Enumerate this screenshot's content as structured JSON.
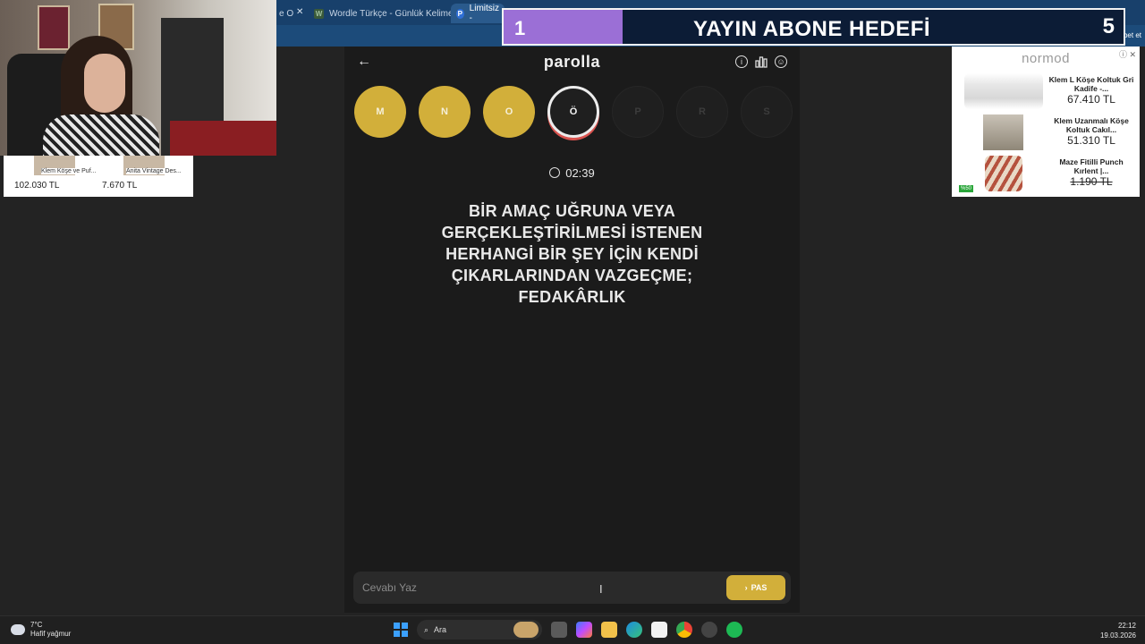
{
  "browser": {
    "tabs": [
      {
        "title": "e O",
        "favicon": ""
      },
      {
        "title": "Wordle Türkçe - Günlük Kelime O",
        "favicon": "W"
      },
      {
        "title": "Limitsiz -",
        "favicon": "P"
      }
    ],
    "copilot_label": "Sohbet et"
  },
  "overlay": {
    "current": "1",
    "title": "YAYIN ABONE HEDEFİ",
    "target": "5",
    "progress": 0.2
  },
  "app": {
    "logo": "parolla",
    "letters": [
      {
        "char": "M",
        "state": "done"
      },
      {
        "char": "N",
        "state": "done"
      },
      {
        "char": "O",
        "state": "done"
      },
      {
        "char": "Ö",
        "state": "current"
      },
      {
        "char": "P",
        "state": "pending"
      },
      {
        "char": "R",
        "state": "pending"
      },
      {
        "char": "S",
        "state": "pending"
      }
    ],
    "timer": "02:39",
    "question": "BİR AMAÇ UĞRUNA VEYA GERÇEKLEŞTİRİLMESİ İSTENEN HERHANGİ BİR ŞEY İÇİN KENDİ ÇIKARLARINDAN VAZGEÇME; FEDAKÂRLIK",
    "answer_placeholder": "Cevabı Yaz",
    "answer_value": "",
    "pass_label": "PAS"
  },
  "left_ad": {
    "items": [
      {
        "name": "Klem Köşe ve Puf...",
        "price": "102.030 TL"
      },
      {
        "name": "Anita Vintage Des...",
        "price": "7.670 TL"
      }
    ]
  },
  "right_ad": {
    "brand": "normod",
    "products": [
      {
        "name": "Klem L Köşe Koltuk Gri Kadife -...",
        "price": "67.410 TL",
        "struck": false
      },
      {
        "name": "Klem Uzanmalı Köşe Koltuk Cakıl...",
        "price": "51.310 TL",
        "struck": false
      },
      {
        "name": "Maze Fitilli Punch Kırlent |...",
        "price": "1.190 TL",
        "struck": true
      }
    ],
    "badge": "%50"
  },
  "taskbar": {
    "temperature": "7°C",
    "weather": "Hafif yağmur",
    "search_placeholder": "Ara",
    "time": "22:12",
    "date": "19.03.2026"
  }
}
